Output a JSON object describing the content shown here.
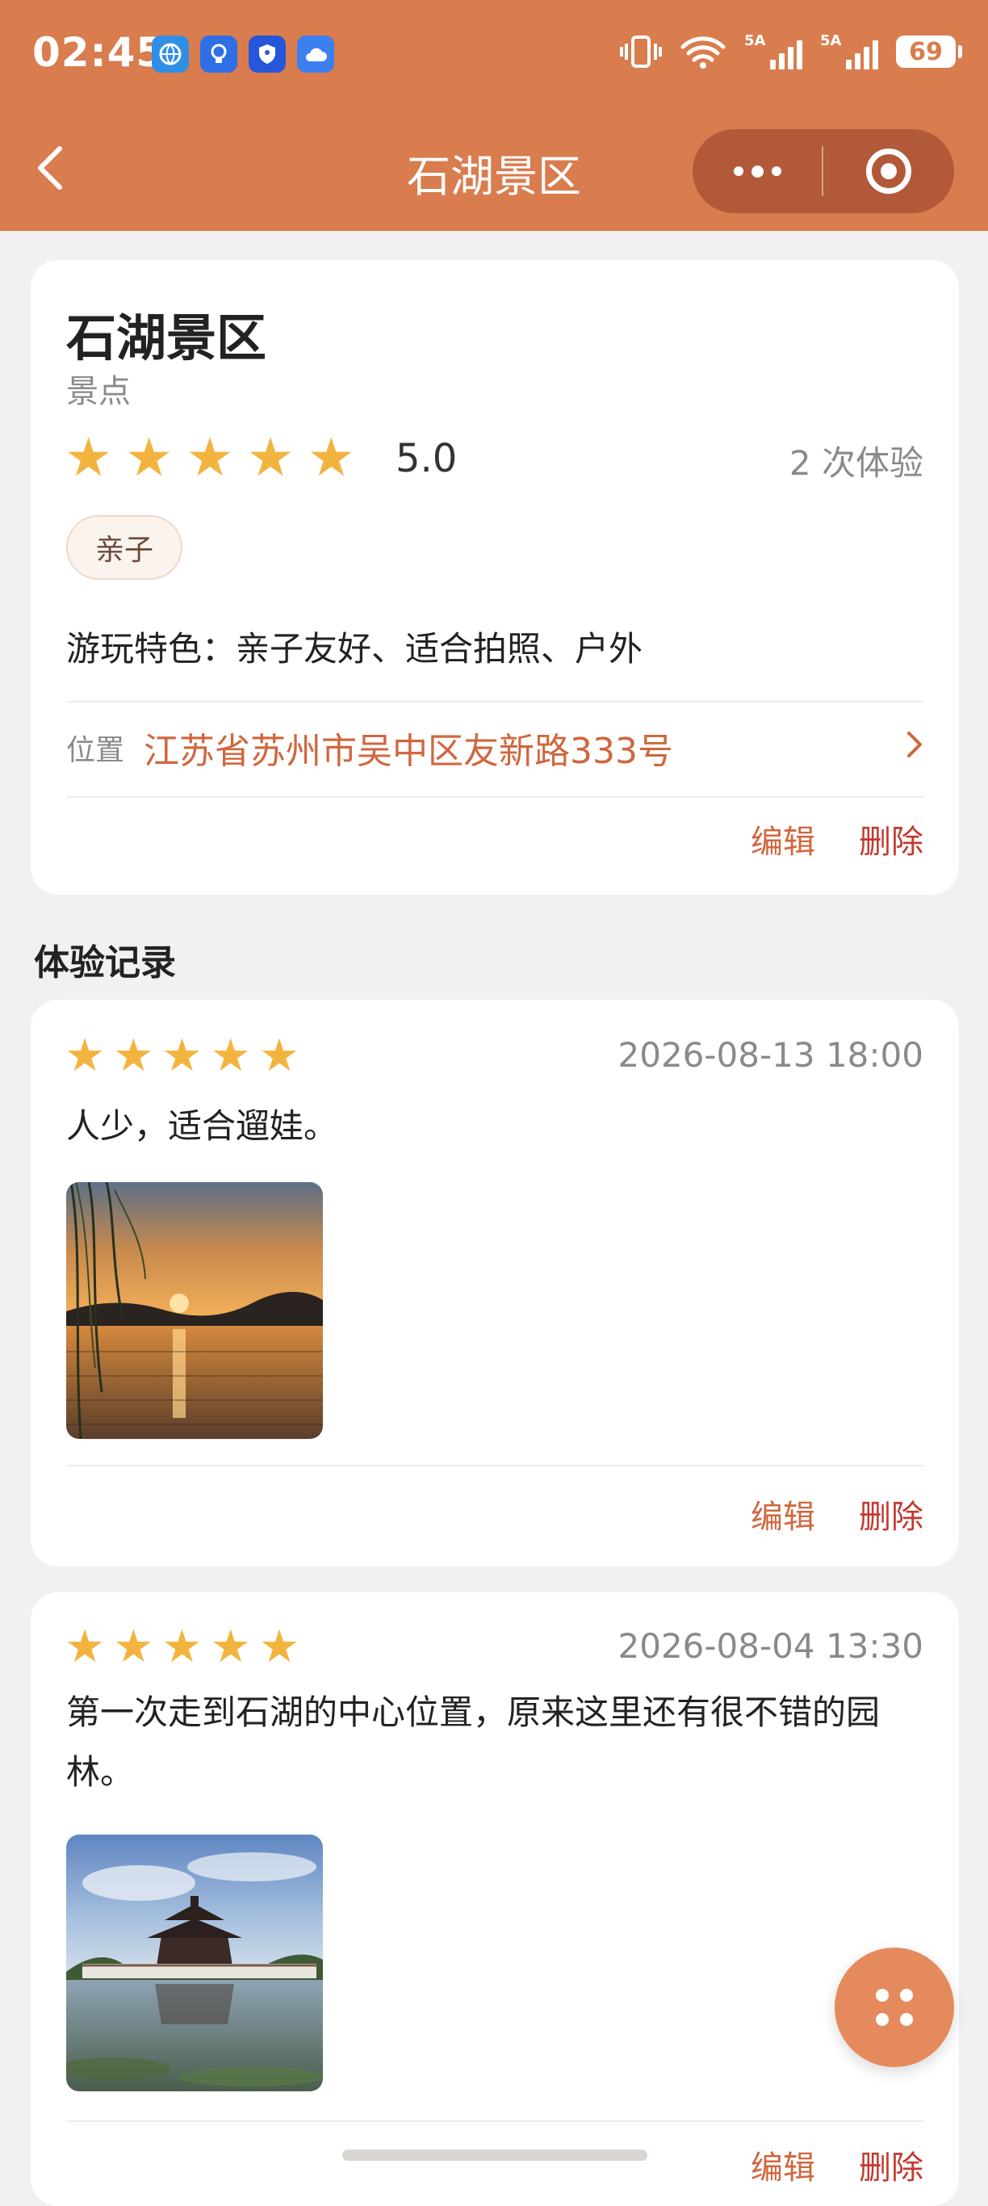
{
  "status_bar": {
    "time": "02:45",
    "signal1_label": "5A",
    "signal2_label": "5A",
    "battery": "69",
    "icons": [
      "browser-icon",
      "lightbulb-icon",
      "shield-icon",
      "cloud-icon",
      "vibrate-icon",
      "wifi-icon"
    ]
  },
  "nav": {
    "title": "石湖景区",
    "back_icon": "chevron-left-icon",
    "more_icon": "more-dots-icon",
    "close_icon": "target-circle-icon"
  },
  "place": {
    "name": "石湖景区",
    "category": "景点",
    "rating": "5.0",
    "stars": 5,
    "experience_count": "2 次体验",
    "tag": "亲子",
    "features": "游玩特色：亲子友好、适合拍照、户外",
    "location_label": "位置",
    "location_address": "江苏省苏州市吴中区友新路333号",
    "edit_label": "编辑",
    "delete_label": "删除"
  },
  "records_title": "体验记录",
  "records": [
    {
      "stars": 5,
      "date": "2026-08-13 18:00",
      "text": "人少，适合遛娃。",
      "photo": "sunset-lake-photo",
      "edit_label": "编辑",
      "delete_label": "删除"
    },
    {
      "stars": 5,
      "date": "2026-08-04 13:30",
      "text": "第一次走到石湖的中心位置，原来这里还有很不错的园林。",
      "photo": "pavilion-lake-photo",
      "edit_label": "编辑",
      "delete_label": "删除"
    }
  ],
  "fab_icon": "grid-dots-icon",
  "colors": {
    "header": "#d97c4e",
    "accent": "#d0673f",
    "delete": "#c23b32",
    "star": "#f3b43f",
    "background": "#f3f1ef"
  }
}
